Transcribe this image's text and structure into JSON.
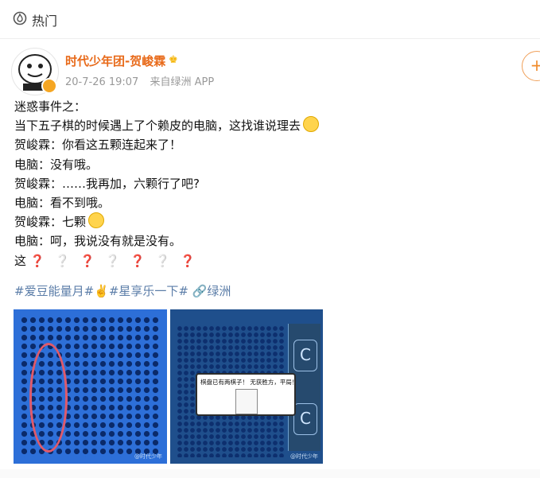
{
  "topbar": {
    "label": "热门",
    "icon": "fire-icon"
  },
  "author": {
    "name": "时代少年团-贺峻霖",
    "crown_glyph": "♚",
    "time": "20-7-26 19:07",
    "source": "来自绿洲 APP",
    "follow_label": "+"
  },
  "post": {
    "line1": "迷惑事件之：",
    "line2": "当下五子棋的时候遇上了个赖皮的电脑，这找谁说理去",
    "line3": "贺峻霖：你看这五颗连起来了！",
    "line4": "电脑：没有哦。",
    "line5": "贺峻霖：……我再加，六颗行了吧?",
    "line6": "电脑：看不到哦。",
    "line7": "贺峻霖：七颗",
    "line8": "电脑：呵，我说没有就是没有。",
    "line9": "这",
    "q_red": "❓",
    "q_white": "❔"
  },
  "tags": {
    "text": "#爱豆能量月#✌️#星享乐一下# 🔗绿洲"
  },
  "images": {
    "dialog_text": "棋盘已有两棋子！ 无获胜方，平局！",
    "watermark1": "@时代少年",
    "watermark2": "@时代少年"
  },
  "colors": {
    "accent": "#e86a1a",
    "link": "#5b7da8",
    "board": "#2d6fd8"
  }
}
